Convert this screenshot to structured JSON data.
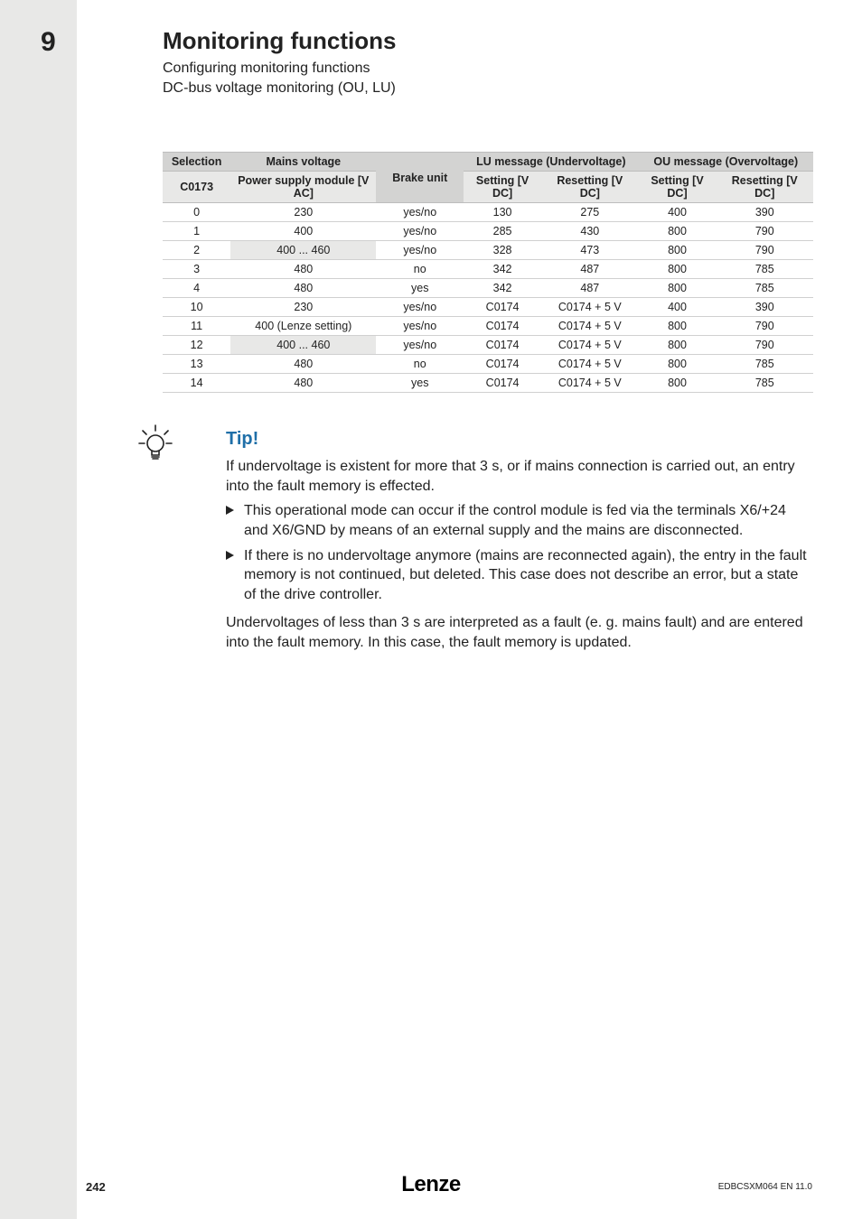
{
  "chapter_number": "9",
  "title": "Monitoring functions",
  "subtitle_line1": "Configuring monitoring functions",
  "subtitle_line2": "DC-bus voltage monitoring (OU, LU)",
  "table": {
    "head_r1": {
      "selection": "Selection",
      "mains": "Mains voltage",
      "brake": "Brake unit",
      "lu": "LU message (Undervoltage)",
      "ou": "OU message (Overvoltage)"
    },
    "head_r2": {
      "selection": "C0173",
      "mains": "Power supply module [V AC]",
      "brake": "",
      "lu_set": "Setting [V DC]",
      "lu_reset": "Resetting [V DC]",
      "ou_set": "Setting [V DC]",
      "ou_reset": "Resetting [V DC]"
    },
    "rows": [
      {
        "sel": "0",
        "mains": "230",
        "brake": "yes/no",
        "lu_s": "130",
        "lu_r": "275",
        "ou_s": "400",
        "ou_r": "390"
      },
      {
        "sel": "1",
        "mains": "400",
        "brake": "yes/no",
        "lu_s": "285",
        "lu_r": "430",
        "ou_s": "800",
        "ou_r": "790"
      },
      {
        "sel": "2",
        "mains": "400 ... 460",
        "brake": "yes/no",
        "lu_s": "328",
        "lu_r": "473",
        "ou_s": "800",
        "ou_r": "790"
      },
      {
        "sel": "3",
        "mains": "480",
        "brake": "no",
        "lu_s": "342",
        "lu_r": "487",
        "ou_s": "800",
        "ou_r": "785"
      },
      {
        "sel": "4",
        "mains": "480",
        "brake": "yes",
        "lu_s": "342",
        "lu_r": "487",
        "ou_s": "800",
        "ou_r": "785"
      },
      {
        "sel": "10",
        "mains": "230",
        "brake": "yes/no",
        "lu_s": "C0174",
        "lu_r": "C0174 + 5 V",
        "ou_s": "400",
        "ou_r": "390"
      },
      {
        "sel": "11",
        "mains": "400 (Lenze setting)",
        "brake": "yes/no",
        "lu_s": "C0174",
        "lu_r": "C0174 + 5 V",
        "ou_s": "800",
        "ou_r": "790"
      },
      {
        "sel": "12",
        "mains": "400 ... 460",
        "brake": "yes/no",
        "lu_s": "C0174",
        "lu_r": "C0174 + 5 V",
        "ou_s": "800",
        "ou_r": "790"
      },
      {
        "sel": "13",
        "mains": "480",
        "brake": "no",
        "lu_s": "C0174",
        "lu_r": "C0174 + 5 V",
        "ou_s": "800",
        "ou_r": "785"
      },
      {
        "sel": "14",
        "mains": "480",
        "brake": "yes",
        "lu_s": "C0174",
        "lu_r": "C0174 + 5 V",
        "ou_s": "800",
        "ou_r": "785"
      }
    ]
  },
  "tip": {
    "title": "Tip!",
    "p1": "If undervoltage is existent for more that 3 s, or if mains connection is carried out, an entry into the fault memory is effected.",
    "b1": "This operational mode can occur if the control module is fed via the terminals X6/+24 and X6/GND by means of an external supply and the mains are disconnected.",
    "b2": "If there is no undervoltage anymore (mains are reconnected again), the entry in the fault memory is not continued, but deleted. This case does not describe an error, but a state of the drive controller.",
    "p2": "Undervoltages of less than 3 s are interpreted as a fault (e. g. mains fault) and are entered into the fault memory. In this case, the fault memory is updated."
  },
  "footer": {
    "page": "242",
    "brand": "Lenze",
    "docid": "EDBCSXM064 EN 11.0"
  }
}
